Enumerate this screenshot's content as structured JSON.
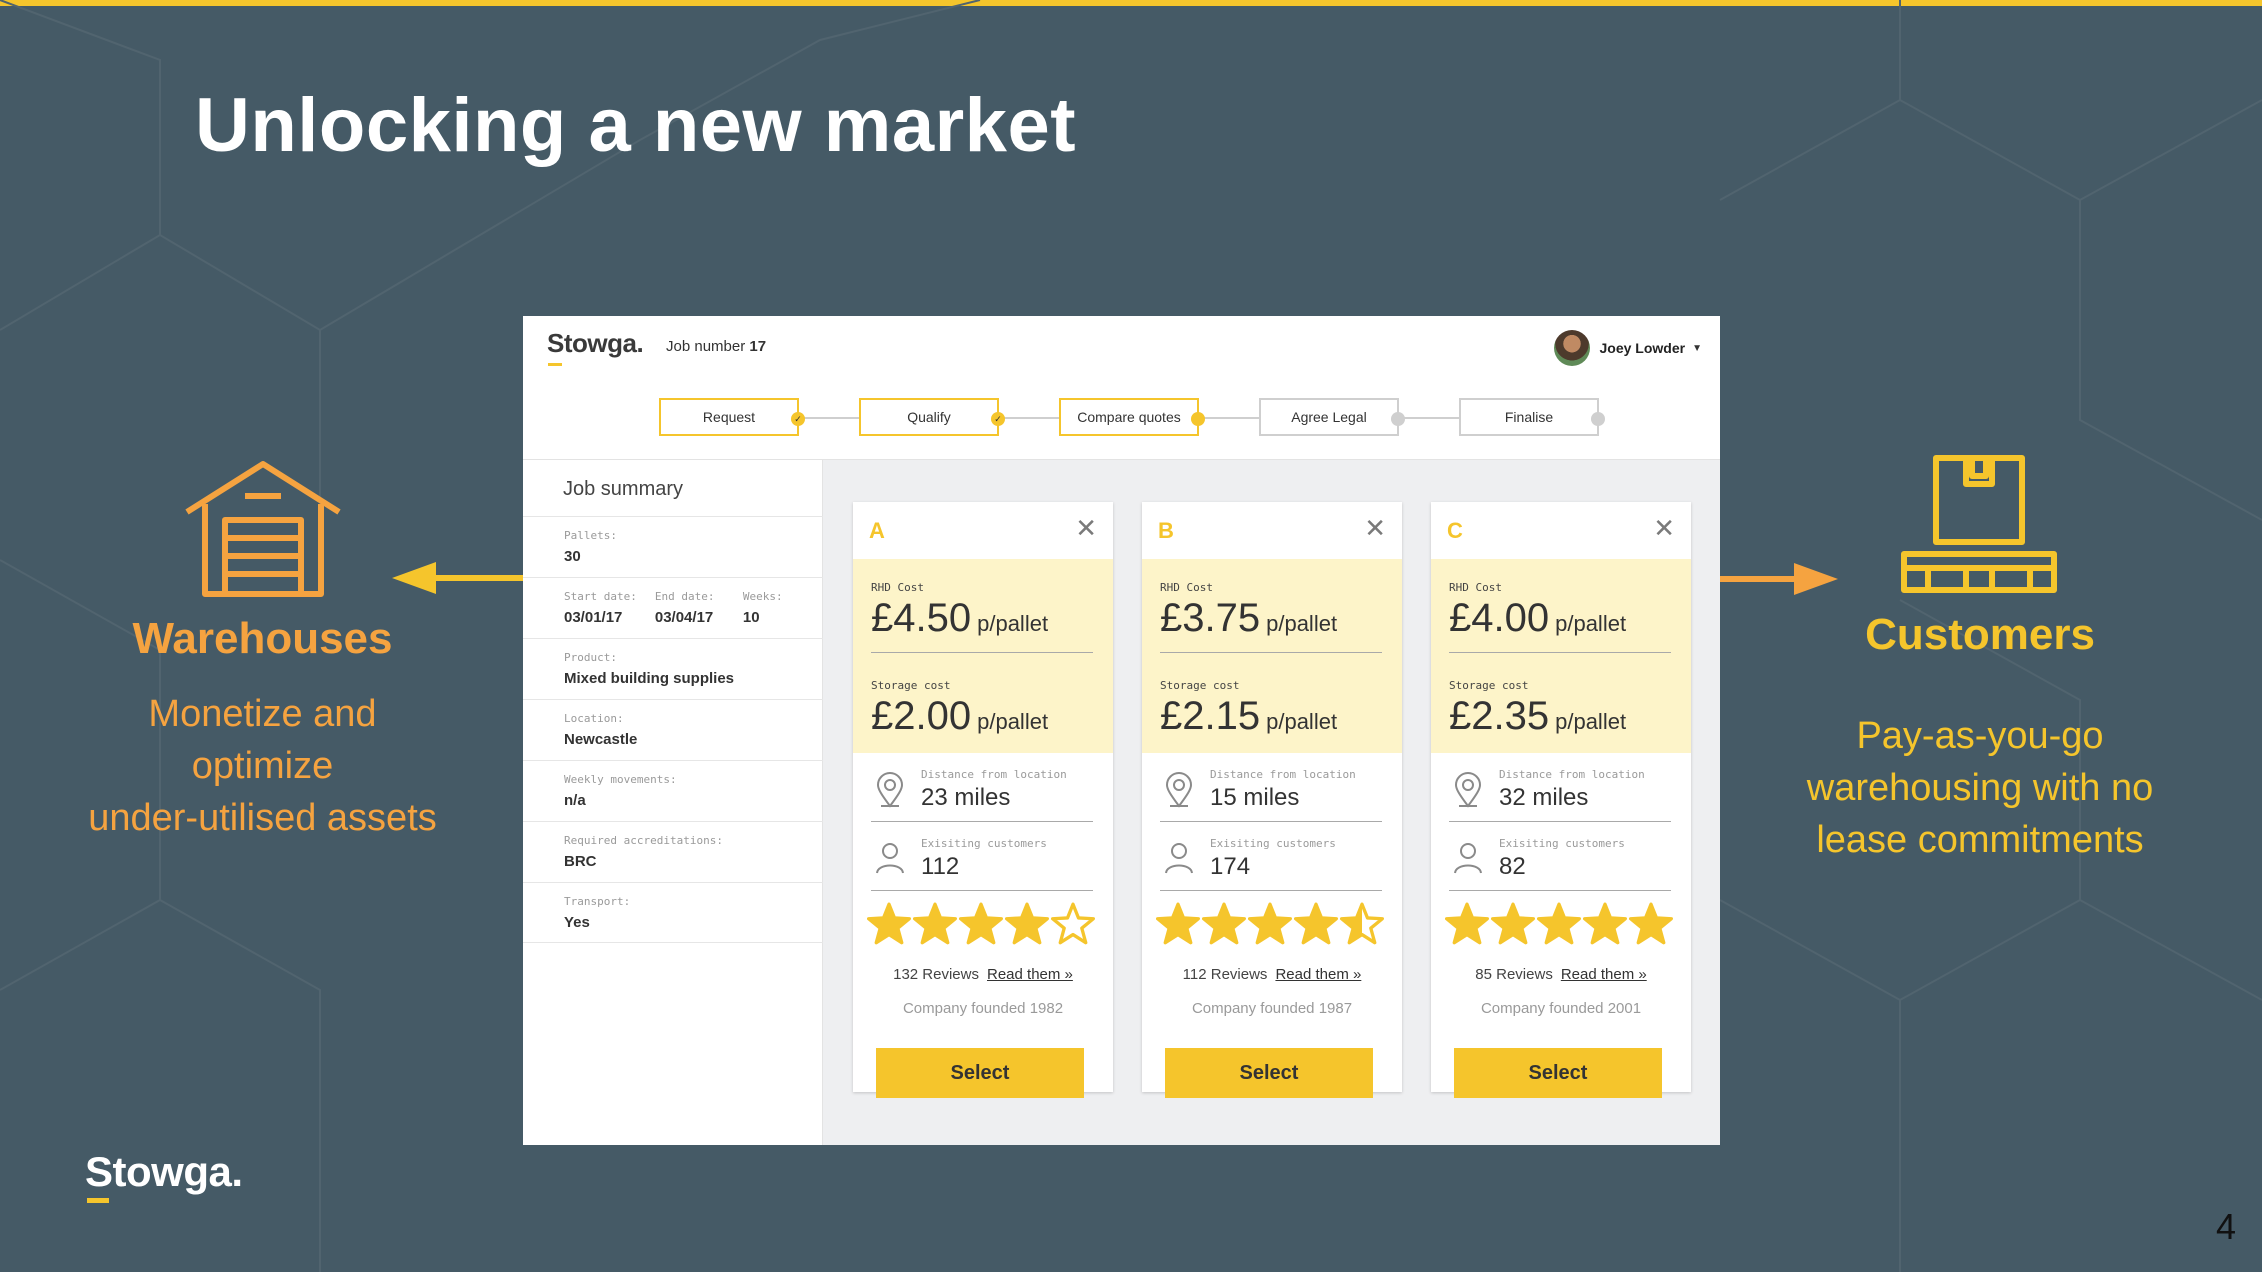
{
  "slide": {
    "title": "Unlocking a new market",
    "page_number": "4",
    "footer_logo": "Stowga.",
    "colors": {
      "background": "#455a66",
      "accent_yellow": "#f5c52c",
      "accent_orange": "#f5a340"
    }
  },
  "left_panel": {
    "icon": "warehouse-icon",
    "heading": "Warehouses",
    "body_lines": [
      "Monetize and",
      "optimize",
      "under-utilised assets"
    ]
  },
  "right_panel": {
    "icon": "pallet-box-icon",
    "heading": "Customers",
    "body_lines": [
      "Pay-as-you-go",
      "warehousing with no",
      "lease commitments"
    ]
  },
  "app": {
    "brand": "Stowga.",
    "job_number_label": "Job number",
    "job_number_value": "17",
    "user_name": "Joey Lowder",
    "steps": [
      {
        "label": "Request",
        "status": "done"
      },
      {
        "label": "Qualify",
        "status": "done"
      },
      {
        "label": "Compare quotes",
        "status": "current"
      },
      {
        "label": "Agree Legal",
        "status": "todo"
      },
      {
        "label": "Finalise",
        "status": "todo"
      }
    ],
    "summary": {
      "title": "Job summary",
      "pallets": {
        "label": "Pallets:",
        "value": "30"
      },
      "start": {
        "label": "Start date:",
        "value": "03/01/17"
      },
      "end": {
        "label": "End date:",
        "value": "03/04/17"
      },
      "weeks": {
        "label": "Weeks:",
        "value": "10"
      },
      "product": {
        "label": "Product:",
        "value": "Mixed building supplies"
      },
      "location": {
        "label": "Location:",
        "value": "Newcastle"
      },
      "movements": {
        "label": "Weekly movements:",
        "value": "n/a"
      },
      "accreditations": {
        "label": "Required accreditations:",
        "value": "BRC"
      },
      "transport": {
        "label": "Transport:",
        "value": "Yes"
      }
    },
    "quote_labels": {
      "rhd": "RHD Cost",
      "storage": "Storage cost",
      "unit": "p/pallet",
      "distance": "Distance from location",
      "customers": "Exisiting customers",
      "read_them": "Read them »",
      "select": "Select"
    },
    "quotes": [
      {
        "letter": "A",
        "rhd_cost": "£4.50",
        "storage_cost": "£2.00",
        "distance": "23 miles",
        "customers": "112",
        "rating": 4,
        "reviews": "132 Reviews",
        "founded": "Company founded 1982"
      },
      {
        "letter": "B",
        "rhd_cost": "£3.75",
        "storage_cost": "£2.15",
        "distance": "15 miles",
        "customers": "174",
        "rating": 4.5,
        "reviews": "112 Reviews",
        "founded": "Company founded 1987"
      },
      {
        "letter": "C",
        "rhd_cost": "£4.00",
        "storage_cost": "£2.35",
        "distance": "32 miles",
        "customers": "82",
        "rating": 5,
        "reviews": "85 Reviews",
        "founded": "Company founded 2001"
      }
    ]
  }
}
